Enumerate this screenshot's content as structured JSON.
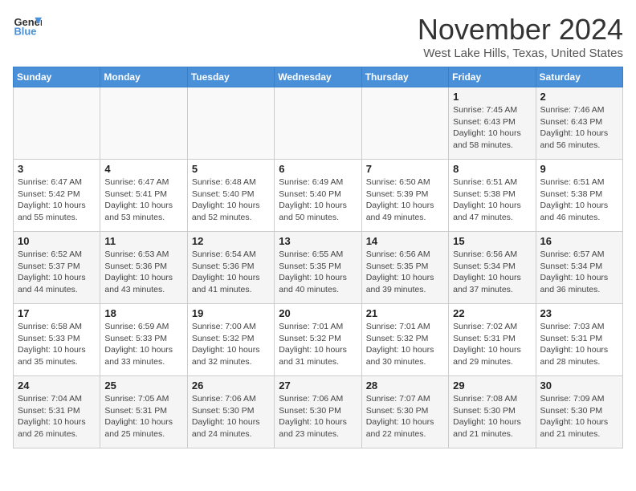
{
  "logo": {
    "line1": "General",
    "line2": "Blue"
  },
  "title": "November 2024",
  "location": "West Lake Hills, Texas, United States",
  "days_of_week": [
    "Sunday",
    "Monday",
    "Tuesday",
    "Wednesday",
    "Thursday",
    "Friday",
    "Saturday"
  ],
  "weeks": [
    [
      {
        "day": "",
        "info": ""
      },
      {
        "day": "",
        "info": ""
      },
      {
        "day": "",
        "info": ""
      },
      {
        "day": "",
        "info": ""
      },
      {
        "day": "",
        "info": ""
      },
      {
        "day": "1",
        "info": "Sunrise: 7:45 AM\nSunset: 6:43 PM\nDaylight: 10 hours\nand 58 minutes."
      },
      {
        "day": "2",
        "info": "Sunrise: 7:46 AM\nSunset: 6:43 PM\nDaylight: 10 hours\nand 56 minutes."
      }
    ],
    [
      {
        "day": "3",
        "info": "Sunrise: 6:47 AM\nSunset: 5:42 PM\nDaylight: 10 hours\nand 55 minutes."
      },
      {
        "day": "4",
        "info": "Sunrise: 6:47 AM\nSunset: 5:41 PM\nDaylight: 10 hours\nand 53 minutes."
      },
      {
        "day": "5",
        "info": "Sunrise: 6:48 AM\nSunset: 5:40 PM\nDaylight: 10 hours\nand 52 minutes."
      },
      {
        "day": "6",
        "info": "Sunrise: 6:49 AM\nSunset: 5:40 PM\nDaylight: 10 hours\nand 50 minutes."
      },
      {
        "day": "7",
        "info": "Sunrise: 6:50 AM\nSunset: 5:39 PM\nDaylight: 10 hours\nand 49 minutes."
      },
      {
        "day": "8",
        "info": "Sunrise: 6:51 AM\nSunset: 5:38 PM\nDaylight: 10 hours\nand 47 minutes."
      },
      {
        "day": "9",
        "info": "Sunrise: 6:51 AM\nSunset: 5:38 PM\nDaylight: 10 hours\nand 46 minutes."
      }
    ],
    [
      {
        "day": "10",
        "info": "Sunrise: 6:52 AM\nSunset: 5:37 PM\nDaylight: 10 hours\nand 44 minutes."
      },
      {
        "day": "11",
        "info": "Sunrise: 6:53 AM\nSunset: 5:36 PM\nDaylight: 10 hours\nand 43 minutes."
      },
      {
        "day": "12",
        "info": "Sunrise: 6:54 AM\nSunset: 5:36 PM\nDaylight: 10 hours\nand 41 minutes."
      },
      {
        "day": "13",
        "info": "Sunrise: 6:55 AM\nSunset: 5:35 PM\nDaylight: 10 hours\nand 40 minutes."
      },
      {
        "day": "14",
        "info": "Sunrise: 6:56 AM\nSunset: 5:35 PM\nDaylight: 10 hours\nand 39 minutes."
      },
      {
        "day": "15",
        "info": "Sunrise: 6:56 AM\nSunset: 5:34 PM\nDaylight: 10 hours\nand 37 minutes."
      },
      {
        "day": "16",
        "info": "Sunrise: 6:57 AM\nSunset: 5:34 PM\nDaylight: 10 hours\nand 36 minutes."
      }
    ],
    [
      {
        "day": "17",
        "info": "Sunrise: 6:58 AM\nSunset: 5:33 PM\nDaylight: 10 hours\nand 35 minutes."
      },
      {
        "day": "18",
        "info": "Sunrise: 6:59 AM\nSunset: 5:33 PM\nDaylight: 10 hours\nand 33 minutes."
      },
      {
        "day": "19",
        "info": "Sunrise: 7:00 AM\nSunset: 5:32 PM\nDaylight: 10 hours\nand 32 minutes."
      },
      {
        "day": "20",
        "info": "Sunrise: 7:01 AM\nSunset: 5:32 PM\nDaylight: 10 hours\nand 31 minutes."
      },
      {
        "day": "21",
        "info": "Sunrise: 7:01 AM\nSunset: 5:32 PM\nDaylight: 10 hours\nand 30 minutes."
      },
      {
        "day": "22",
        "info": "Sunrise: 7:02 AM\nSunset: 5:31 PM\nDaylight: 10 hours\nand 29 minutes."
      },
      {
        "day": "23",
        "info": "Sunrise: 7:03 AM\nSunset: 5:31 PM\nDaylight: 10 hours\nand 28 minutes."
      }
    ],
    [
      {
        "day": "24",
        "info": "Sunrise: 7:04 AM\nSunset: 5:31 PM\nDaylight: 10 hours\nand 26 minutes."
      },
      {
        "day": "25",
        "info": "Sunrise: 7:05 AM\nSunset: 5:31 PM\nDaylight: 10 hours\nand 25 minutes."
      },
      {
        "day": "26",
        "info": "Sunrise: 7:06 AM\nSunset: 5:30 PM\nDaylight: 10 hours\nand 24 minutes."
      },
      {
        "day": "27",
        "info": "Sunrise: 7:06 AM\nSunset: 5:30 PM\nDaylight: 10 hours\nand 23 minutes."
      },
      {
        "day": "28",
        "info": "Sunrise: 7:07 AM\nSunset: 5:30 PM\nDaylight: 10 hours\nand 22 minutes."
      },
      {
        "day": "29",
        "info": "Sunrise: 7:08 AM\nSunset: 5:30 PM\nDaylight: 10 hours\nand 21 minutes."
      },
      {
        "day": "30",
        "info": "Sunrise: 7:09 AM\nSunset: 5:30 PM\nDaylight: 10 hours\nand 21 minutes."
      }
    ]
  ]
}
